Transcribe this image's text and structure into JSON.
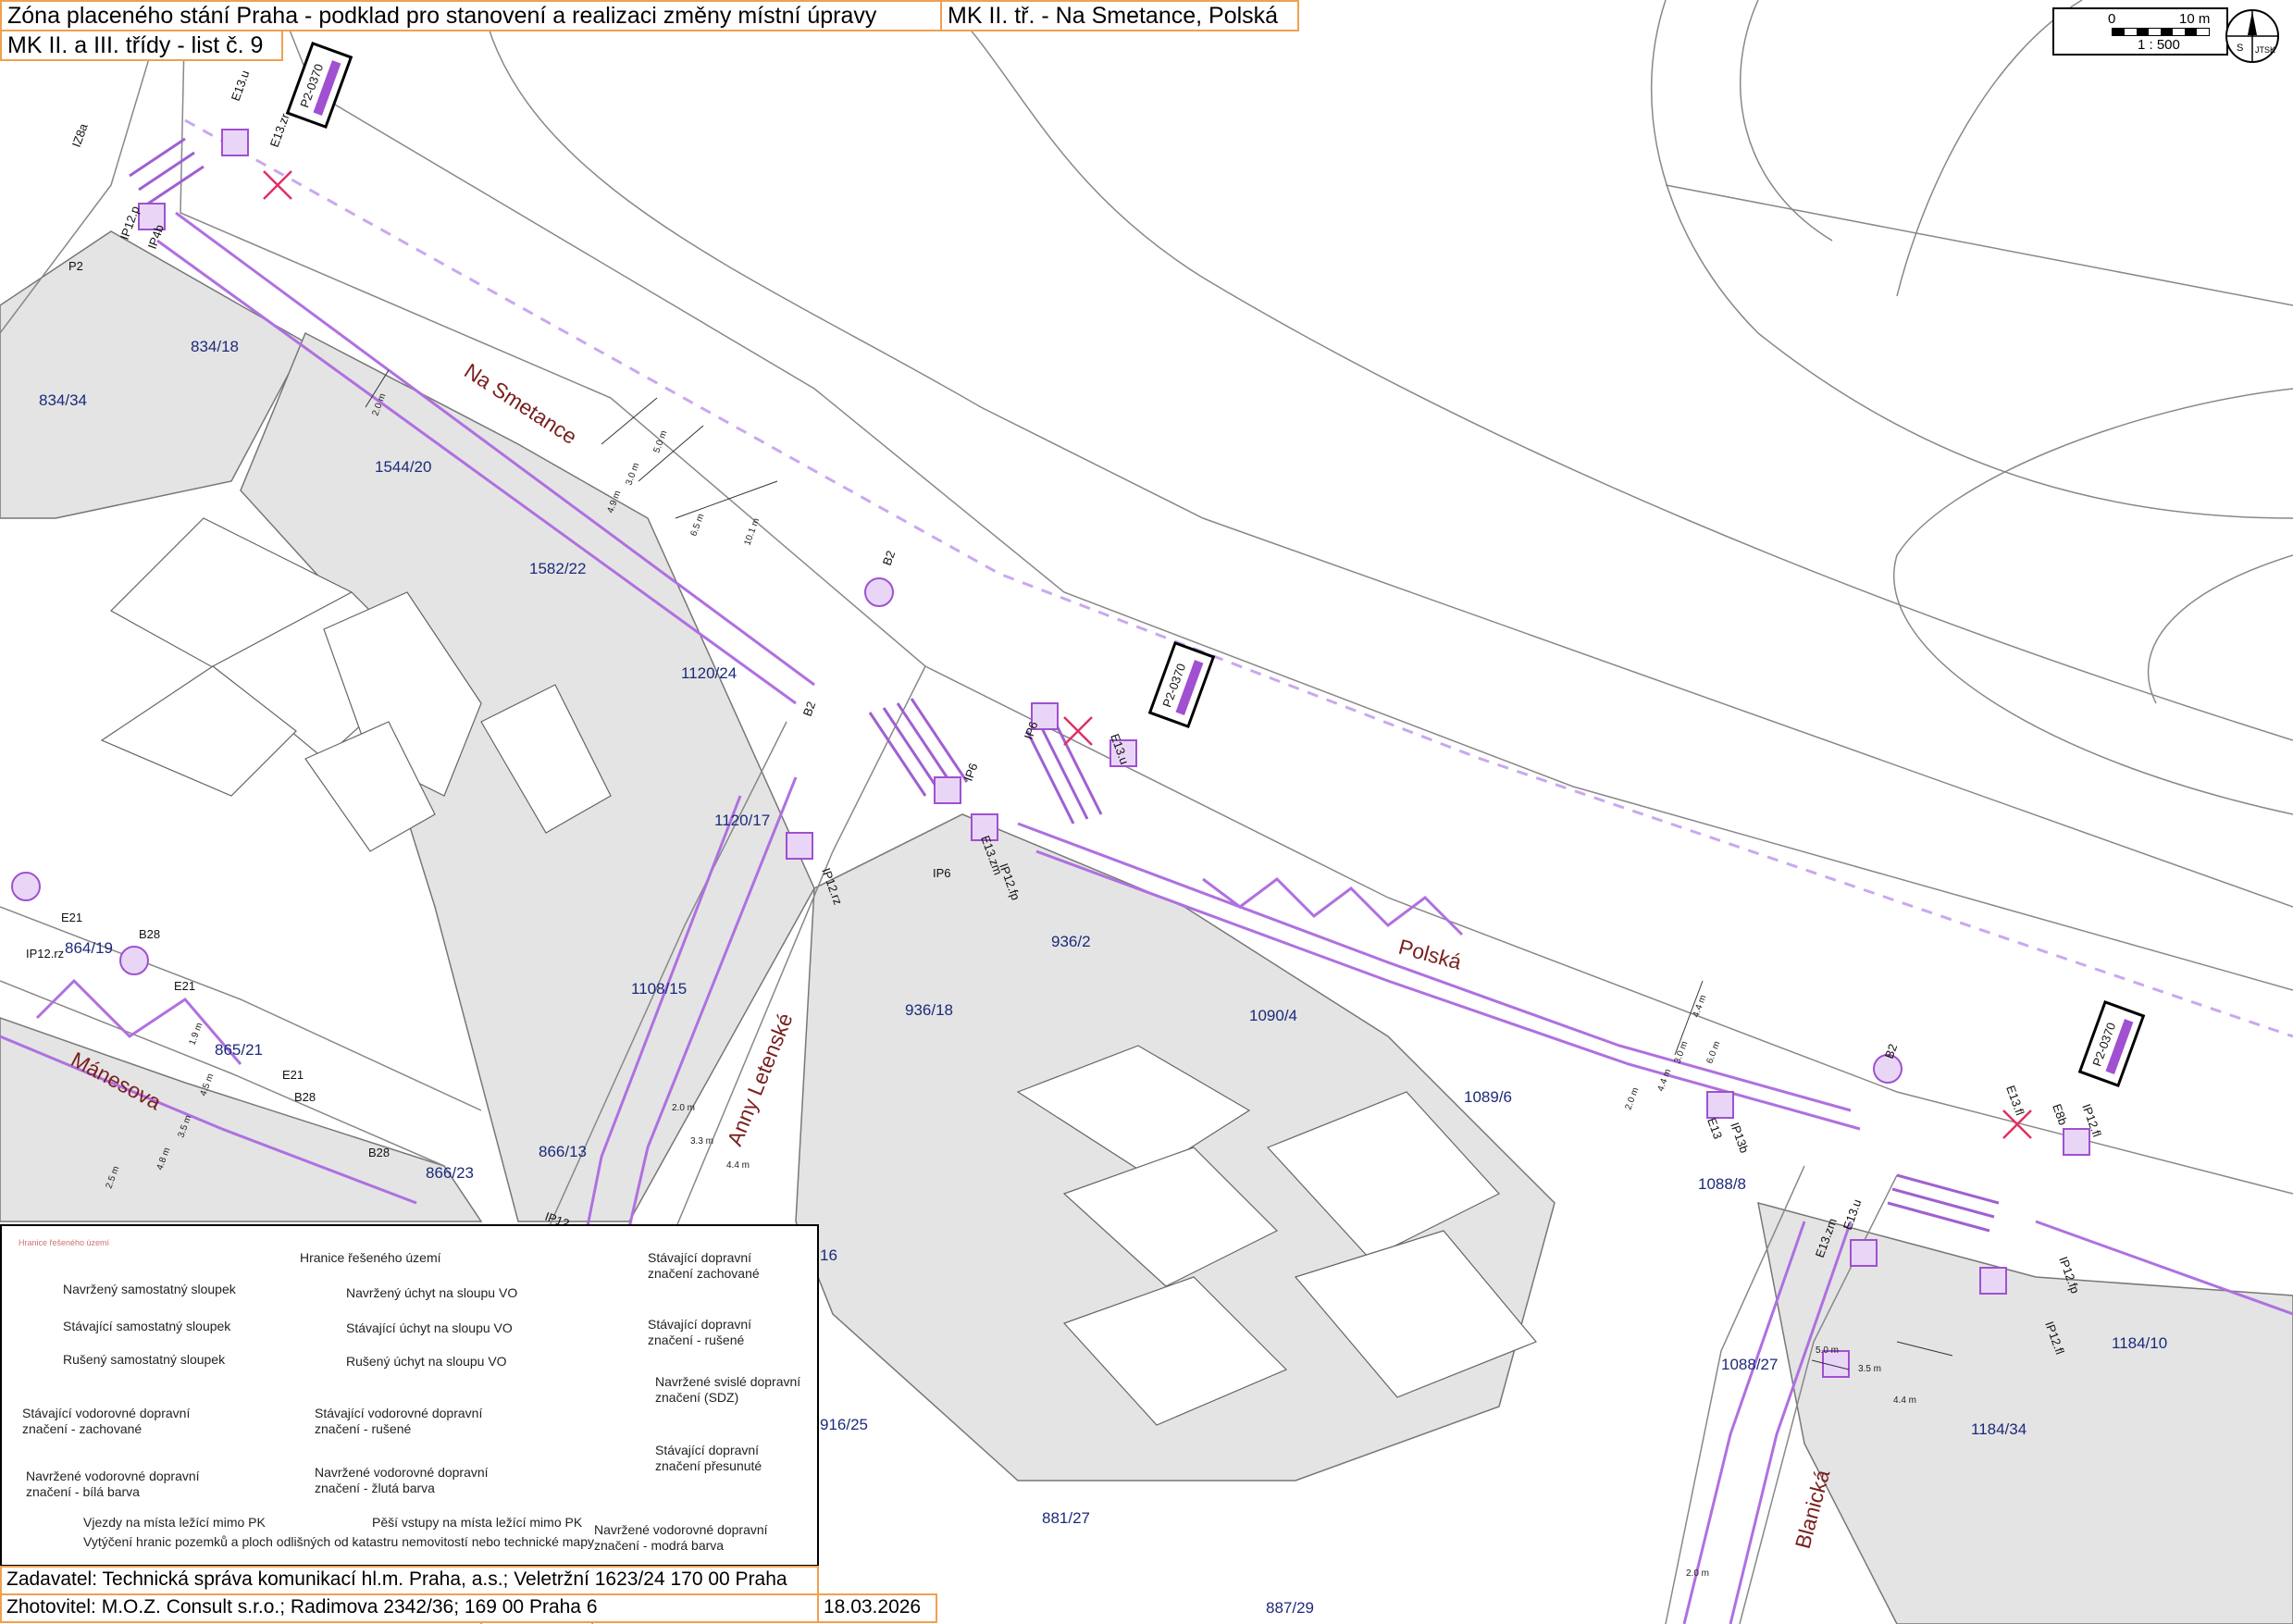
{
  "header": {
    "title": "Zóna placeného stání Praha - podklad pro stanovení a realizaci změny místní úpravy",
    "location": "MK II. tř. - Na Smetance, Polská",
    "sheet": "MK II. a III. třídy - list č. 9"
  },
  "scale": {
    "zero": "0",
    "ten": "10 m",
    "ratio": "1 : 500"
  },
  "north": {
    "s": "S",
    "jtsk": "JTSK"
  },
  "streets": {
    "na_smetance": "Na Smetance",
    "polska": "Polská",
    "manesova": "Mánesova",
    "anny_letenske": "Anny Letenské",
    "blanicka": "Blanická"
  },
  "parcels": {
    "p1": "834/18",
    "p2": "834/34",
    "p3": "1544/20",
    "p4": "1582/22",
    "p5": "1120/24",
    "p6": "1120/17",
    "p7": "1108/15",
    "p8": "936/2",
    "p9": "936/18",
    "p10": "1090/4",
    "p11": "1089/6",
    "p12": "1088/8",
    "p13": "864/19",
    "p14": "865/21",
    "p15": "866/23",
    "p16": "866/13",
    "p17": "1088/27",
    "p18": "1184/10",
    "p19": "1184/34",
    "p20": "881/27",
    "p21": "887/29",
    "p22": "916/25",
    "p23": "16"
  },
  "signs": {
    "s1": "E13.u",
    "s2": "IP12.p",
    "s3": "E13.zr",
    "s4": "P2",
    "s5": "IP4b",
    "s6": "B2",
    "s7": "IP6",
    "s8": "IP12.rz",
    "s9": "E13.zm",
    "s10": "IP12.fp",
    "s11": "E21",
    "s12": "B28",
    "s13": "IP12.rz",
    "s14": "E13",
    "s15": "IP13b",
    "s16": "E8b",
    "s17": "IP12.c",
    "s18": "IP12.fp",
    "s19": "IP12.fl",
    "s20": "E13.fl",
    "s21": "IZ8a"
  },
  "sign_board": "P2-0370",
  "dims": {
    "d1": "2.0 m",
    "d2": "5.0 m",
    "d3": "3.0 m",
    "d4": "4.9 m",
    "d5": "6.5 m",
    "d6": "10.1 m",
    "d7": "4.4 m",
    "d8": "6.0 m",
    "d9": "1.9 m",
    "d10": "4.5 m",
    "d11": "3.5 m",
    "d12": "4.8 m",
    "d13": "2.5 m",
    "d14": "3.3 m",
    "d15": "3.5 m",
    "d16": "5.0 m"
  },
  "legend": {
    "boundary": "Hranice řešeného území",
    "boundary2": "Hranice řešeného území",
    "item1": "Navržený samostatný sloupek",
    "item2": "Stávající samostatný sloupek",
    "item3": "Rušený samostatný sloupek",
    "item4": "Navržený úchyt na sloupu VO",
    "item5": "Stávající úchyt na sloupu VO",
    "item6": "Rušený úchyt na sloupu VO",
    "item7": "Stávající dopravní značení zachované",
    "item8": "Stávající dopravní značení - rušené",
    "item9": "Navržené svislé dopravní značení (SDZ)",
    "item10": "Stávající dopravní značení přesunuté",
    "item11": "Stávající vodorovné dopravní značení - zachované",
    "item12": "Stávající vodorovné dopravní značení - rušené",
    "item13": "Navržené vodorovné dopravní značení - bílá barva",
    "item14": "Navržené vodorovné dopravní značení - žlutá barva",
    "item15": "Navržené vodorovné dopravní značení - modrá barva",
    "item16": "Vjezdy na místa ležící mimo PK",
    "item17": "Pěší vstupy na místa ležící mimo PK",
    "item18": "Vytýčení hranic pozemků a ploch odlišných od katastru nemovitostí nebo technické mapy"
  },
  "footer": {
    "client": "Zadavatel: Technická správa komunikací hl.m. Praha, a.s.; Veletržní 1623/24 170 00 Praha",
    "contractor": "Zhotovitel: M.O.Z. Consult s.r.o.; Radimova 2342/36; 169 00 Praha 6",
    "date": "18.03.2026"
  },
  "colors": {
    "purple": "#a050d0",
    "violet_line": "#b070e0",
    "red": "#e03060",
    "parcel_label": "#1c2a7a",
    "street_label": "#7a1f1f",
    "header_border": "#f0a050"
  }
}
